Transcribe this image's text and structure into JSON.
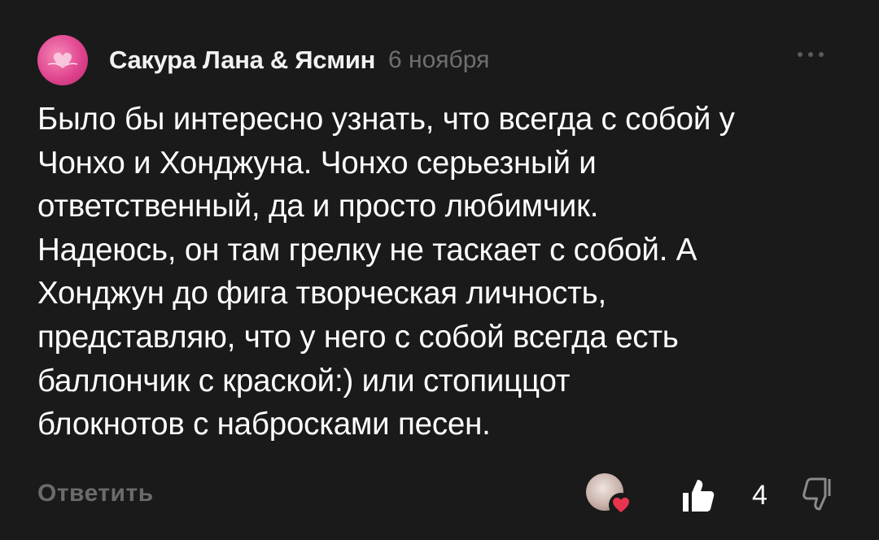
{
  "comment": {
    "author": "Сакура Лана & Ясмин",
    "date": "6 ноября",
    "text": "Было бы интересно узнать, что всегда с собой у\nЧонхо и Хонджуна. Чонхо серьезный и\nответственный, да и просто любимчик.\nНадеюсь, он там грелку не таскает с собой. А\nХонджун до фига творческая личность,\nпредставляю, что у него с собой всегда есть\nбаллончик с краской:) или стопиццот\nблокнотов с набросками песен.",
    "reply_label": "Ответить",
    "like_count": "4"
  },
  "icons": {
    "more": "more-horizontal-icon",
    "like": "thumbs-up-icon",
    "dislike": "thumbs-down-icon",
    "author_heart": "heart-icon"
  },
  "colors": {
    "background": "#1a1a1a",
    "text": "#ffffff",
    "muted": "#6f6f6f",
    "heart": "#e8344e",
    "avatar_pink": "#e0458f"
  }
}
